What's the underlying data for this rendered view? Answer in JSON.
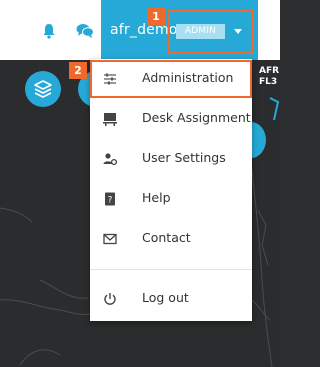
{
  "topbar": {
    "username": "afr_demo",
    "role_badge": "ADMIN"
  },
  "map": {
    "label_line1": "AFR",
    "label_line2": "FL3"
  },
  "menu": {
    "items": [
      {
        "label": "Administration",
        "icon": "sliders-icon"
      },
      {
        "label": "Desk Assignment",
        "icon": "desk-icon"
      },
      {
        "label": "User Settings",
        "icon": "user-settings-icon"
      },
      {
        "label": "Help",
        "icon": "help-book-icon"
      },
      {
        "label": "Contact",
        "icon": "envelope-icon"
      },
      {
        "label": "Log out",
        "icon": "power-icon"
      }
    ]
  },
  "annotations": {
    "step1": "1",
    "step2": "2",
    "color": "#ee6a2c"
  },
  "colors": {
    "accent": "#26a9d6",
    "badge_bg": "#a8dff2",
    "map_bg": "#2a2c2d"
  }
}
